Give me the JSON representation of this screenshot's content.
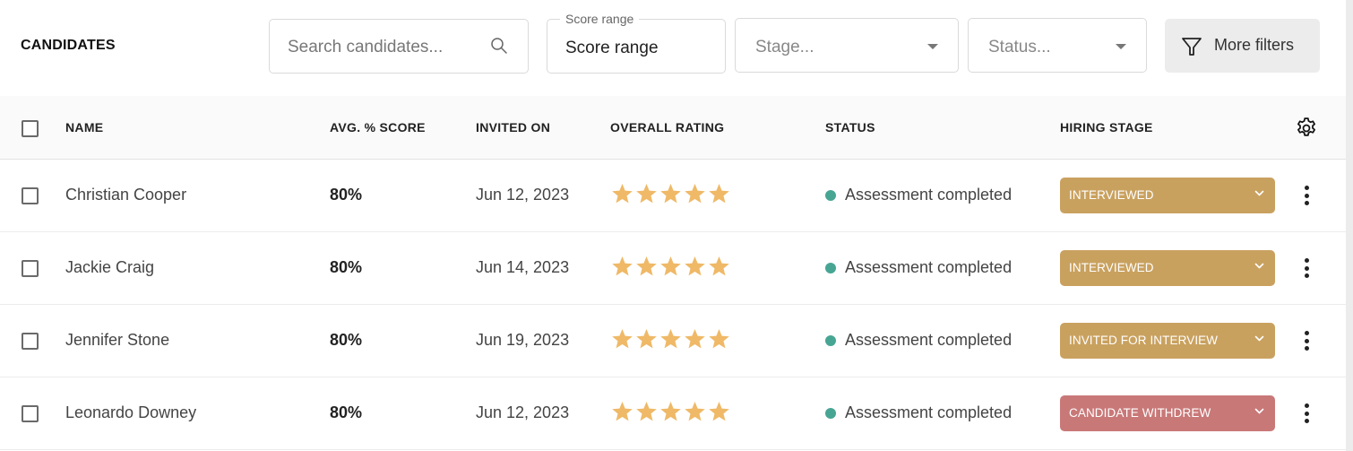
{
  "header": {
    "title": "CANDIDATES",
    "search": {
      "placeholder": "Search candidates...",
      "icon": "search-icon"
    },
    "score_range": {
      "legend": "Score range",
      "value": "Score range"
    },
    "stage_select": {
      "placeholder": "Stage..."
    },
    "status_select": {
      "placeholder": "Status..."
    },
    "more_filters": {
      "label": "More filters",
      "icon": "filter-icon"
    }
  },
  "table": {
    "columns": {
      "name": "NAME",
      "score": "AVG. % SCORE",
      "invited": "INVITED ON",
      "rating": "OVERALL RATING",
      "status": "STATUS",
      "stage": "HIRING STAGE"
    },
    "settings_icon": "gear-icon",
    "rows": [
      {
        "name": "Christian Cooper",
        "score": "80%",
        "invited": "Jun 12, 2023",
        "rating": 5,
        "status": "Assessment completed",
        "stage": "INTERVIEWED",
        "stage_color": "#c9a15f"
      },
      {
        "name": "Jackie Craig",
        "score": "80%",
        "invited": "Jun 14, 2023",
        "rating": 5,
        "status": "Assessment completed",
        "stage": "INTERVIEWED",
        "stage_color": "#c9a15f"
      },
      {
        "name": "Jennifer Stone",
        "score": "80%",
        "invited": "Jun 19, 2023",
        "rating": 5,
        "status": "Assessment completed",
        "stage": "INVITED FOR INTERVIEW",
        "stage_color": "#c9a15f"
      },
      {
        "name": "Leonardo Downey",
        "score": "80%",
        "invited": "Jun 12, 2023",
        "rating": 5,
        "status": "Assessment completed",
        "stage": "CANDIDATE WITHDREW",
        "stage_color": "#c97878"
      }
    ]
  },
  "colors": {
    "star": "#efb967",
    "status_dot": "#47a594",
    "stage_gold": "#c9a15f",
    "stage_red": "#c97878"
  }
}
